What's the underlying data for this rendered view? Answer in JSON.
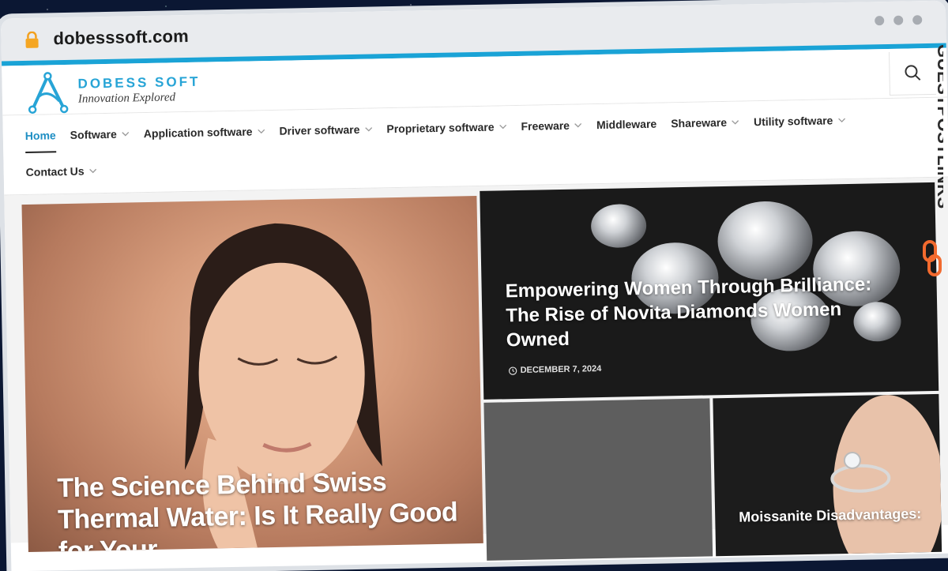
{
  "browser": {
    "url": "dobesssoft.com",
    "accent": "#1aa3d6"
  },
  "site": {
    "logo_name": "DOBESS SOFT",
    "logo_tagline": "Innovation Explored",
    "brand_color": "#27a4d6"
  },
  "nav": {
    "items": [
      {
        "label": "Home",
        "active": true,
        "has_dropdown": false
      },
      {
        "label": "Software",
        "has_dropdown": true
      },
      {
        "label": "Application software",
        "has_dropdown": true
      },
      {
        "label": "Driver software",
        "has_dropdown": true
      },
      {
        "label": "Proprietary software",
        "has_dropdown": true
      },
      {
        "label": "Freeware",
        "has_dropdown": true
      },
      {
        "label": "Middleware",
        "has_dropdown": false
      },
      {
        "label": "Shareware",
        "has_dropdown": true
      },
      {
        "label": "Utility software",
        "has_dropdown": true
      },
      {
        "label": "Contact Us",
        "has_dropdown": true
      }
    ]
  },
  "posts": [
    {
      "title": "The Science Behind Swiss Thermal Water: Is It Really Good for Your"
    },
    {
      "title": "Empowering Women Through Brilliance: The Rise of Novita Diamonds Women Owned",
      "date": "DECEMBER 7, 2024"
    },
    {
      "title": ""
    },
    {
      "title": "Moissanite Disadvantages:"
    }
  ],
  "watermark": {
    "text": "GUESTPOSTLINKS"
  }
}
